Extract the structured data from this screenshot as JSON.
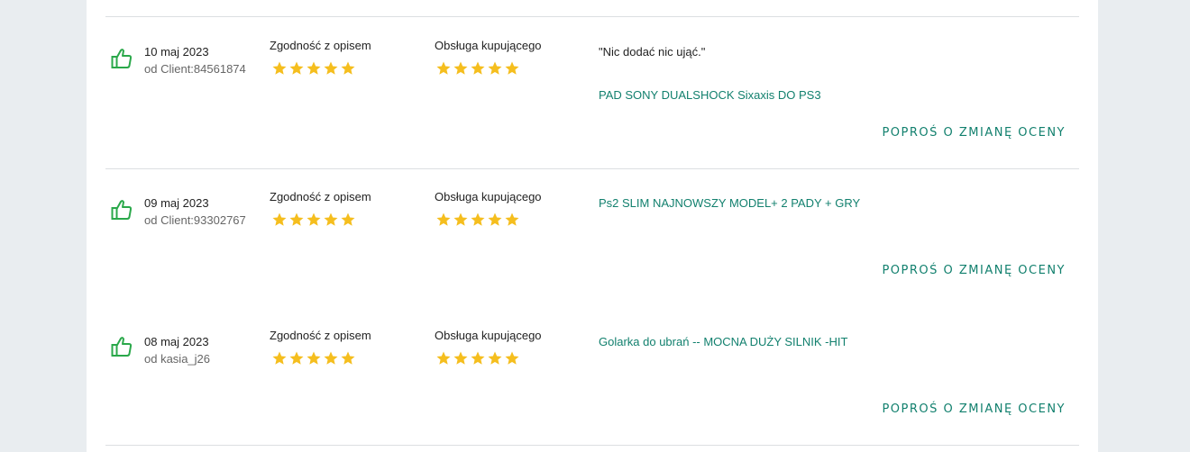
{
  "colors": {
    "accent": "#12806e",
    "star": "#f5be1e",
    "thumb": "#2aa84a"
  },
  "reviews": [
    {
      "date": "10 maj 2023",
      "author": "od Client:84561874",
      "criteria": [
        {
          "label": "Zgodność z opisem",
          "rating": 5
        },
        {
          "label": "Obsługa kupującego",
          "rating": 5
        }
      ],
      "comment": "\"Nic dodać nic ująć.\"",
      "offer": "PAD SONY DUALSHOCK Sixaxis DO PS3",
      "action": "POPROŚ O ZMIANĘ OCENY"
    },
    {
      "date": "09 maj 2023",
      "author": "od Client:93302767",
      "criteria": [
        {
          "label": "Zgodność z opisem",
          "rating": 5
        },
        {
          "label": "Obsługa kupującego",
          "rating": 5
        }
      ],
      "comment": "",
      "offer": "Ps2 SLIM NAJNOWSZY MODEL+ 2 PADY + GRY",
      "action": "POPROŚ O ZMIANĘ OCENY"
    },
    {
      "date": "08 maj 2023",
      "author": "od kasia_j26",
      "criteria": [
        {
          "label": "Zgodność z opisem",
          "rating": 5
        },
        {
          "label": "Obsługa kupującego",
          "rating": 5
        }
      ],
      "comment": "",
      "offer": "Golarka do ubrań -- MOCNA DUŻY SILNIK -HIT",
      "action": "POPROŚ O ZMIANĘ OCENY"
    }
  ]
}
